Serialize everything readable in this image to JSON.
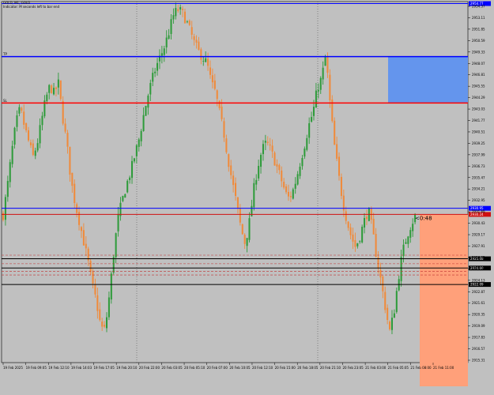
{
  "header": {
    "symbol_line": "GOLD, M1, GOLD",
    "info_line": "Indicator: M seconds left to bar end"
  },
  "colors": {
    "background": "#c0c0c0",
    "bull": "#2e9b3a",
    "bear": "#f08a3a",
    "blue_line": "#0000ff",
    "red_line": "#ff0000",
    "black_line": "#000000",
    "tp_zone": "#6495ed",
    "sl_zone": "#ffa07a",
    "grid_dotted": "#555555"
  },
  "chart_data": {
    "type": "candlestick",
    "title": "GOLD, M1, GOLD",
    "ylim": [
      2913.0,
      2955.0
    ],
    "y_ticks": [
      "2954.37",
      "2953.11",
      "2951.85",
      "2950.59",
      "2949.33",
      "2948.07",
      "2946.81",
      "2945.55",
      "2944.29",
      "2943.03",
      "2941.77",
      "2940.51",
      "2939.25",
      "2937.99",
      "2936.73",
      "2935.47",
      "2934.21",
      "2932.95",
      "2931.69",
      "2930.43",
      "2929.17",
      "2927.91",
      "2926.65",
      "2925.39",
      "2924.13",
      "2922.87",
      "2921.61",
      "2920.35",
      "2919.09",
      "2917.83",
      "2916.57",
      "2915.31"
    ],
    "x_ticks": [
      "19 Feb 2025",
      "19 Feb 09:05",
      "19 Feb 12:10",
      "19 Feb 14:03",
      "19 Feb 17:05",
      "19 Feb 20:10",
      "20 Feb 22:00",
      "20 Feb 03:05",
      "20 Feb 05:10",
      "20 Feb 07:00",
      "20 Feb 10:05",
      "20 Feb 12:10",
      "20 Feb 15:00",
      "20 Feb 18:05",
      "20 Feb 21:10",
      "20 Feb 23:05",
      "21 Feb 03:00",
      "21 Feb 05:05",
      "21 Feb 08:00",
      "21 Feb 11:00"
    ],
    "price_path": [
      2930.2,
      2933.5,
      2937.4,
      2940.8,
      2942.6,
      2940.5,
      2938.7,
      2936.9,
      2938.4,
      2941.0,
      2943.6,
      2945.2,
      2944.3,
      2945.5,
      2941.6,
      2938.4,
      2934.1,
      2931.4,
      2929.3,
      2927.0,
      2924.7,
      2922.0,
      2920.0,
      2917.1,
      2916.8,
      2920.8,
      2925.6,
      2929.7,
      2931.8,
      2933.6,
      2935.2,
      2937.1,
      2939.0,
      2941.6,
      2943.9,
      2945.8,
      2947.4,
      2948.6,
      2949.8,
      2951.4,
      2953.3,
      2954.1,
      2953.8,
      2952.9,
      2951.6,
      2950.2,
      2949.2,
      2948.5,
      2947.8,
      2945.6,
      2944.4,
      2941.9,
      2939.6,
      2936.6,
      2933.9,
      2931.4,
      2928.6,
      2926.8,
      2929.4,
      2933.1,
      2935.9,
      2937.8,
      2938.6,
      2937.7,
      2936.4,
      2935.0,
      2933.5,
      2932.1,
      2932.6,
      2934.3,
      2936.4,
      2938.4,
      2940.6,
      2942.2,
      2944.9,
      2946.1,
      2948.8,
      2943.0,
      2938.3,
      2934.8,
      2931.7,
      2929.4,
      2927.6,
      2926.4,
      2927.7,
      2929.4,
      2930.8,
      2928.3,
      2925.1,
      2922.4,
      2919.4,
      2916.6,
      2918.7,
      2922.6,
      2925.7,
      2927.6,
      2929.0,
      2930.0
    ],
    "levels": [
      {
        "label": "2954.77",
        "price": 2954.77,
        "color": "#0000ff"
      },
      {
        "label": "TP",
        "price": 2948.6,
        "color": "#0000ff"
      },
      {
        "label": "SL",
        "price": 2943.2,
        "color": "#ff0000"
      },
      {
        "label": "2930.95",
        "price": 2930.95,
        "color": "#0000ff"
      },
      {
        "label": "2930.24",
        "price": 2930.24,
        "color": "#d01010"
      },
      {
        "label": "2925.08",
        "price": 2925.08,
        "color": "#000000"
      },
      {
        "label": "2924.00",
        "price": 2924.0,
        "color": "#000000"
      },
      {
        "label": "2922.09",
        "price": 2922.09,
        "color": "#000000"
      }
    ],
    "dashed_levels": [
      2925.5,
      2924.5,
      2923.6,
      2923.2
    ],
    "annotation": "<0:48",
    "current_price_tag": "2930.24"
  }
}
